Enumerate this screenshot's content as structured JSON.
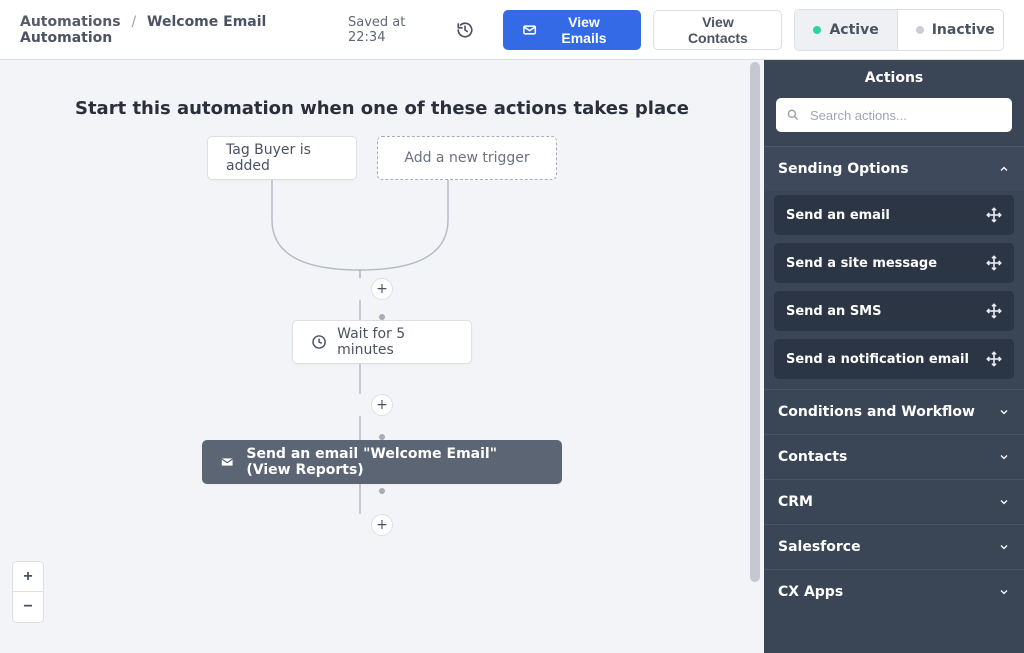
{
  "breadcrumb": {
    "section": "Automations",
    "title": "Welcome Email Automation"
  },
  "header": {
    "saved_label": "Saved at 22:34",
    "view_emails": "View Emails",
    "view_contacts": "View Contacts",
    "active": "Active",
    "inactive": "Inactive"
  },
  "canvas": {
    "heading": "Start this automation when one of these actions takes place",
    "trigger_existing": "Tag Buyer is added",
    "trigger_add": "Add a new trigger",
    "wait_label": "Wait for 5 minutes",
    "email_label": "Send an email \"Welcome Email\" (View Reports)",
    "zoom_plus": "+",
    "zoom_minus": "−"
  },
  "sidebar": {
    "title": "Actions",
    "search_placeholder": "Search actions...",
    "cat_sending": "Sending Options",
    "items": [
      "Send an email",
      "Send a site message",
      "Send an SMS",
      "Send a notification email"
    ],
    "cat_conditions": "Conditions and Workflow",
    "cat_contacts": "Contacts",
    "cat_crm": "CRM",
    "cat_salesforce": "Salesforce",
    "cat_cxapps": "CX Apps"
  }
}
